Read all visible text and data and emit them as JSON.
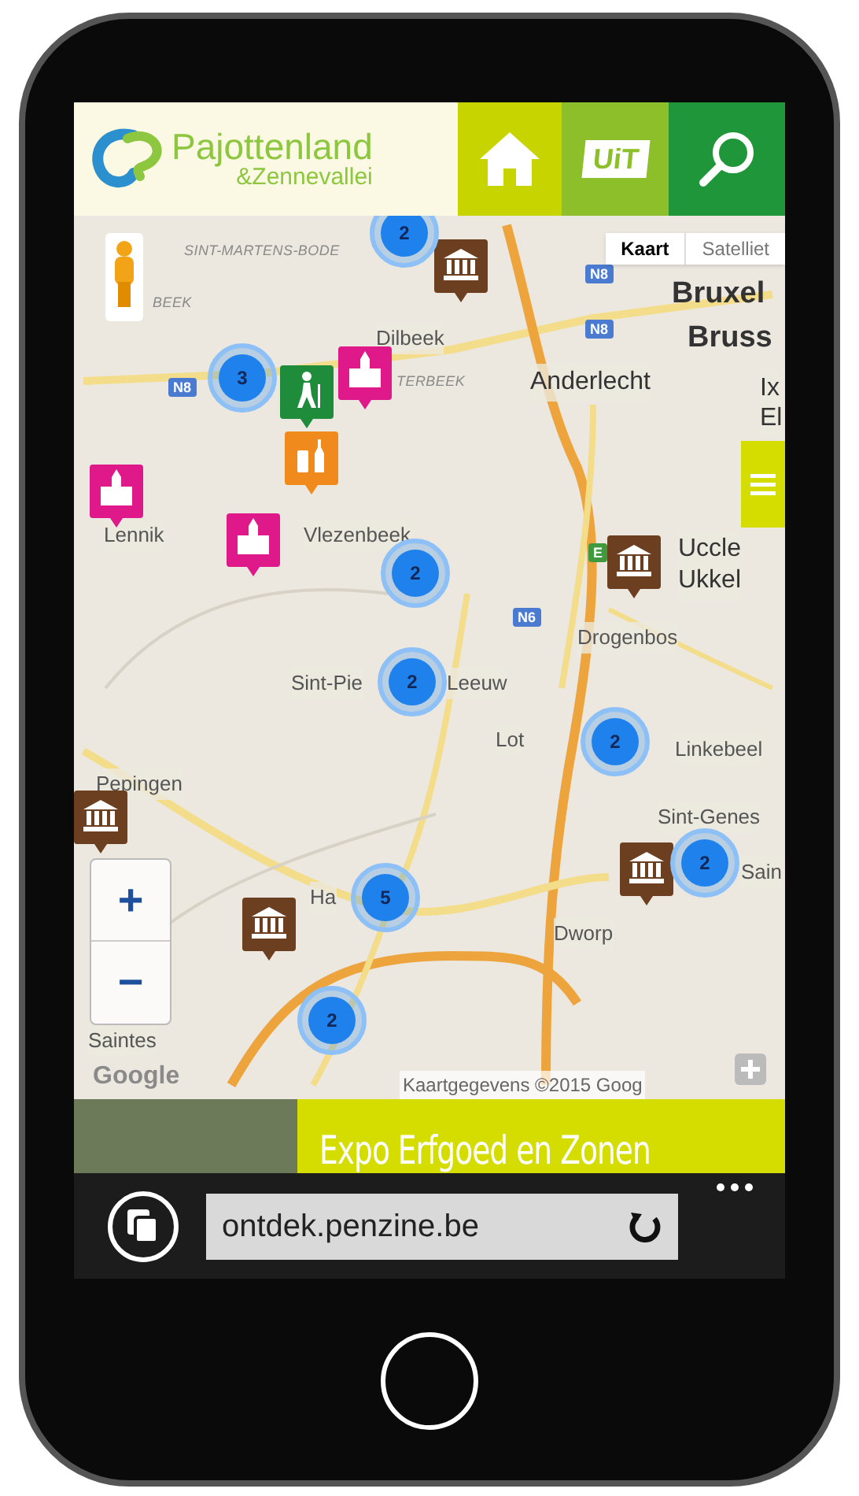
{
  "header": {
    "logo": {
      "name": "Pajottenland",
      "subtitle": "&Zennevallei"
    },
    "buttons": [
      {
        "kind": "home"
      },
      {
        "kind": "uit",
        "label": "UiT"
      },
      {
        "kind": "search"
      }
    ]
  },
  "map": {
    "type_control": [
      {
        "label": "Kaart",
        "selected": true
      },
      {
        "label": "Satelliet",
        "selected": false
      }
    ],
    "zoom": {
      "in": "+",
      "out": "−"
    },
    "labels": [
      {
        "text": "SINT-MARTENS-BODE",
        "kind": "district"
      },
      {
        "text": "BEEK",
        "kind": "district"
      },
      {
        "text": "Dilbeek",
        "kind": "place"
      },
      {
        "text": "TERBEEK",
        "kind": "district"
      },
      {
        "text": "Anderlecht",
        "kind": "town"
      },
      {
        "text": "Bruxel",
        "kind": "city"
      },
      {
        "text": "Bruss",
        "kind": "city"
      },
      {
        "text": "Ix",
        "kind": "town"
      },
      {
        "text": "El",
        "kind": "town"
      },
      {
        "text": "Lennik",
        "kind": "place"
      },
      {
        "text": "Vlezenbeek",
        "kind": "place"
      },
      {
        "text": "Uccle",
        "kind": "town"
      },
      {
        "text": "Ukkel",
        "kind": "town"
      },
      {
        "text": "Drogenbos",
        "kind": "place"
      },
      {
        "text": "Sint-Pie",
        "kind": "place"
      },
      {
        "text": "Leeuw",
        "kind": "place"
      },
      {
        "text": "Lot",
        "kind": "place"
      },
      {
        "text": "Linkebeel",
        "kind": "place"
      },
      {
        "text": "Pepingen",
        "kind": "place"
      },
      {
        "text": "Sint-Genes",
        "kind": "place"
      },
      {
        "text": "Sain",
        "kind": "place"
      },
      {
        "text": "Dworp",
        "kind": "place"
      },
      {
        "text": "Ha",
        "kind": "place"
      },
      {
        "text": "Saintes",
        "kind": "place"
      },
      {
        "text": "N8",
        "kind": "shield"
      },
      {
        "text": "N8",
        "kind": "shield"
      },
      {
        "text": "N8",
        "kind": "shield"
      },
      {
        "text": "N6",
        "kind": "shield"
      },
      {
        "text": "E",
        "kind": "exit"
      }
    ],
    "clusters": [
      "2",
      "3",
      "2",
      "2",
      "2",
      "2",
      "5",
      "2"
    ],
    "pins": [
      {
        "kind": "museum",
        "color": "#6b3f1f"
      },
      {
        "kind": "castle",
        "color": "#e0198a"
      },
      {
        "kind": "hiking",
        "color": "#1e8c3a"
      },
      {
        "kind": "drinks",
        "color": "#f08a1c"
      },
      {
        "kind": "castle",
        "color": "#e0198a"
      },
      {
        "kind": "castle",
        "color": "#e0198a"
      },
      {
        "kind": "museum",
        "color": "#6b3f1f"
      },
      {
        "kind": "museum",
        "color": "#6b3f1f"
      },
      {
        "kind": "museum",
        "color": "#6b3f1f"
      },
      {
        "kind": "museum",
        "color": "#6b3f1f"
      }
    ],
    "logo": "Google",
    "attribution": "Kaartgegevens ©2015 Goog"
  },
  "banner": {
    "title": "Expo Erfgoed en Zonen"
  },
  "browser": {
    "url": "ontdek.penzine.be"
  }
}
